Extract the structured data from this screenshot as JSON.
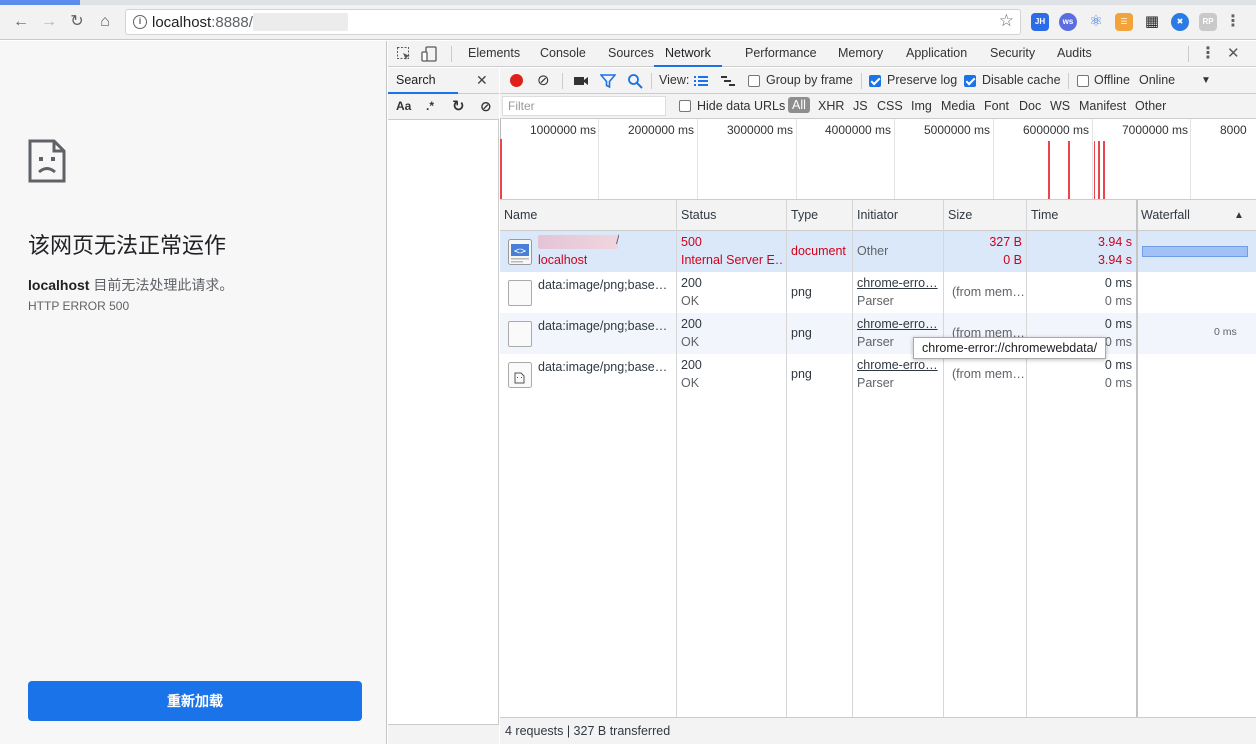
{
  "browser": {
    "url_host": "localhost",
    "url_port": ":8888/",
    "extensions": [
      {
        "name": "JH",
        "color": "#2b6de8"
      },
      {
        "name": "ws",
        "color": "#5b6ee1"
      },
      {
        "name": "react",
        "color": "#3f7ad6"
      },
      {
        "name": "stack",
        "color": "#f2a33a"
      },
      {
        "name": "qr",
        "color": "#333333"
      },
      {
        "name": "x",
        "color": "#2a7be4"
      },
      {
        "name": "RP",
        "color": "#c9c9c9"
      }
    ]
  },
  "error_page": {
    "title": "该网页无法正常运作",
    "host": "localhost",
    "description": " 目前无法处理此请求。",
    "code": "HTTP ERROR 500",
    "reload_label": "重新加载"
  },
  "devtools": {
    "tabs": [
      "Elements",
      "Console",
      "Sources",
      "Network",
      "Performance",
      "Memory",
      "Application",
      "Security",
      "Audits"
    ],
    "active_tab": "Network",
    "search": {
      "tab_label": "Search",
      "case_label": "Aa",
      "regex_label": ".*"
    },
    "network_bar": {
      "view_label": "View:",
      "group_by_frame": "Group by frame",
      "preserve_log": "Preserve log",
      "disable_cache": "Disable cache",
      "offline": "Offline",
      "throttle": "Online"
    },
    "filter": {
      "placeholder": "Filter",
      "hide_data_urls": "Hide data URLs",
      "types": [
        "All",
        "XHR",
        "JS",
        "CSS",
        "Img",
        "Media",
        "Font",
        "Doc",
        "WS",
        "Manifest",
        "Other"
      ]
    },
    "overview_labels": [
      "1000000 ms",
      "2000000 ms",
      "3000000 ms",
      "4000000 ms",
      "5000000 ms",
      "6000000 ms",
      "7000000 ms",
      "8000"
    ],
    "columns": [
      "Name",
      "Status",
      "Type",
      "Initiator",
      "Size",
      "Time",
      "Waterfall"
    ],
    "rows": [
      {
        "name_top": "/",
        "name_bottom": "localhost",
        "status_top": "500",
        "status_bottom": "Internal Server E…",
        "type": "document",
        "initiator_top": "Other",
        "initiator_bottom": "",
        "size_top": "327 B",
        "size_bottom": "0 B",
        "time_top": "3.94 s",
        "time_bottom": "3.94 s"
      },
      {
        "name_top": "data:image/png;base…",
        "name_bottom": "",
        "status_top": "200",
        "status_bottom": "OK",
        "type": "png",
        "initiator_top": "chrome-erro…",
        "initiator_bottom": "Parser",
        "size_top": "(from mem…",
        "size_bottom": "",
        "time_top": "0 ms",
        "time_bottom": "0 ms"
      },
      {
        "name_top": "data:image/png;base…",
        "name_bottom": "",
        "status_top": "200",
        "status_bottom": "OK",
        "type": "png",
        "initiator_top": "chrome-erro…",
        "initiator_bottom": "Parser",
        "size_top": "(from mem…",
        "size_bottom": "",
        "time_top": "0 ms",
        "time_bottom": "0 ms",
        "waterfall": "0 ms"
      },
      {
        "name_top": "data:image/png;base…",
        "name_bottom": "",
        "status_top": "200",
        "status_bottom": "OK",
        "type": "png",
        "initiator_top": "chrome-erro…",
        "initiator_bottom": "Parser",
        "size_top": "(from mem…",
        "size_bottom": "",
        "time_top": "0 ms",
        "time_bottom": "0 ms"
      }
    ],
    "tooltip": "chrome-error://chromewebdata/",
    "summary": "4 requests | 327 B transferred"
  }
}
